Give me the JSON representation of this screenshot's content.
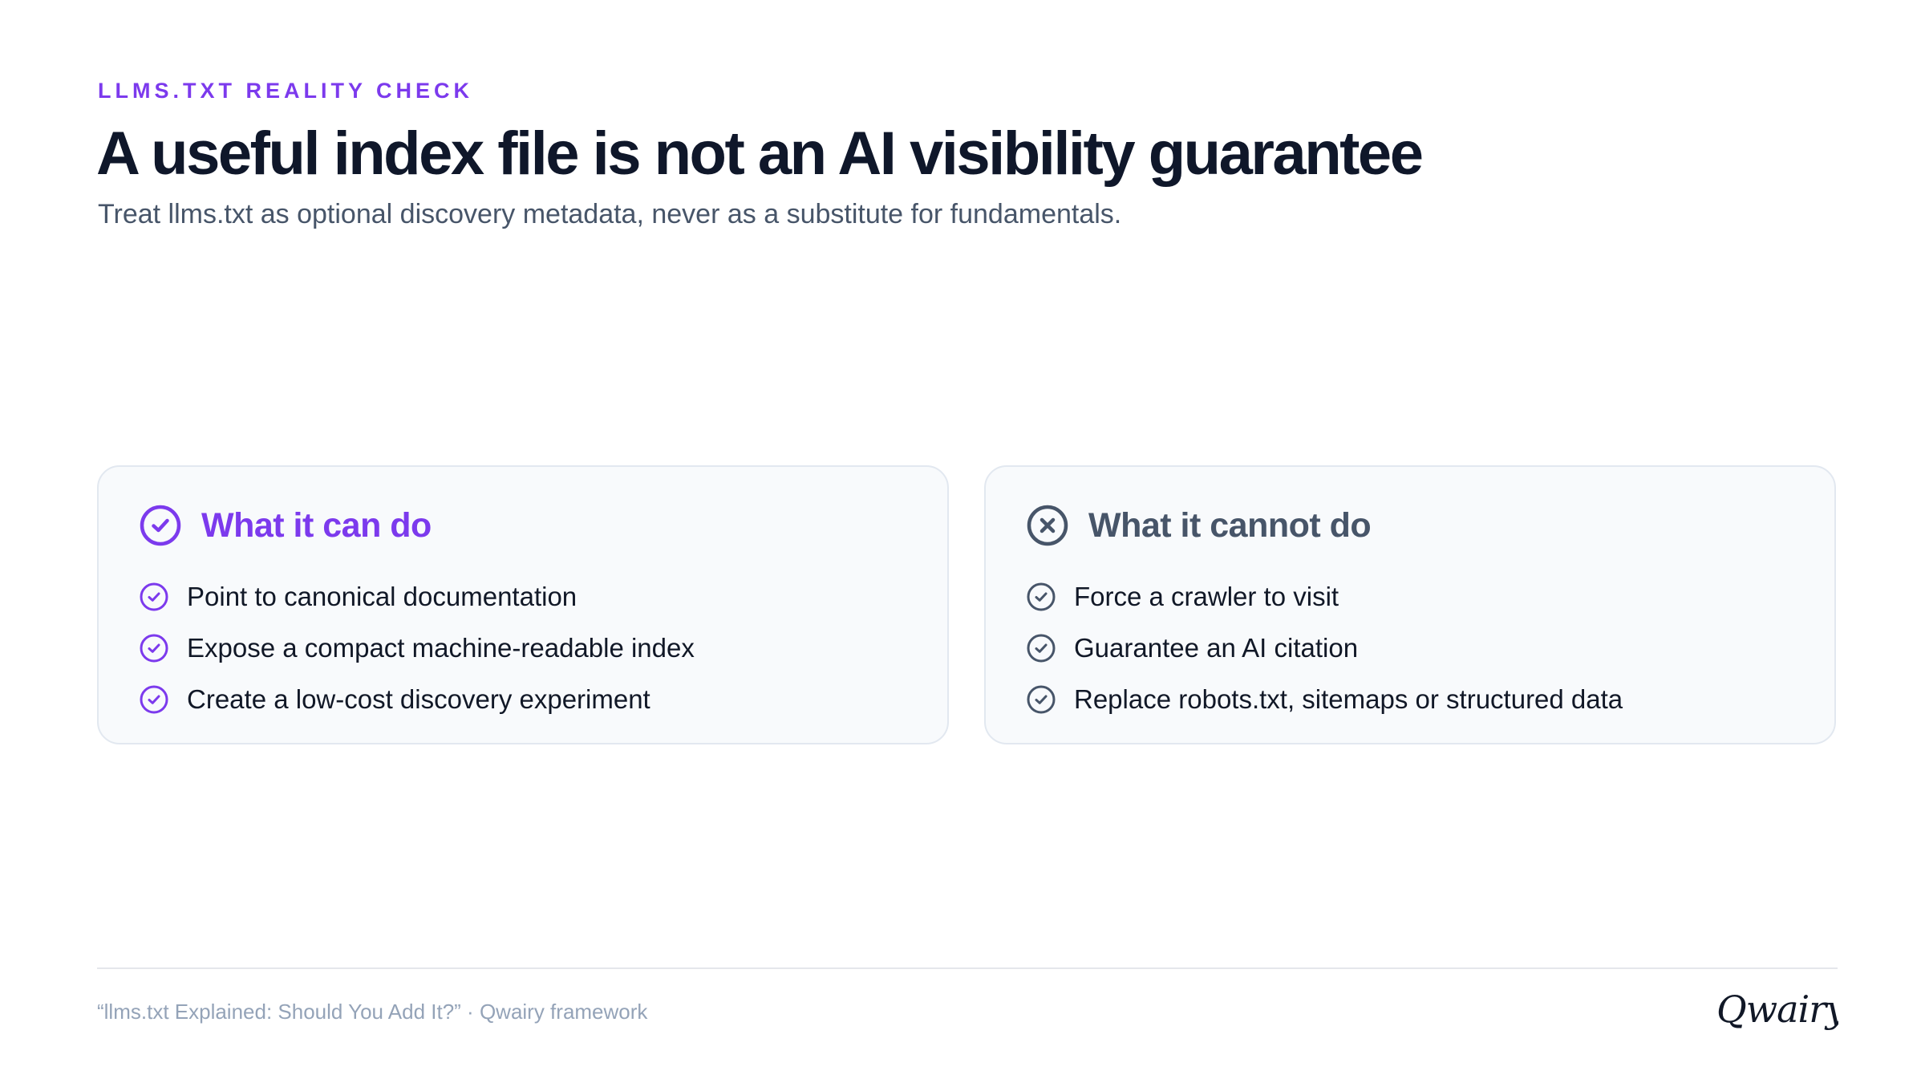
{
  "header": {
    "eyebrow": "LLMS.TXT REALITY CHECK",
    "title": "A useful index file is not an AI visibility guarantee",
    "subtitle": "Treat llms.txt as optional discovery metadata, never as a substitute for fundamentals."
  },
  "cards": {
    "can": {
      "title": "What it can do",
      "icon": "check-circle-icon",
      "color": "#7c3aed",
      "items": [
        "Point to canonical documentation",
        "Expose a compact machine-readable index",
        "Create a low-cost discovery experiment"
      ]
    },
    "cannot": {
      "title": "What it cannot do",
      "icon": "x-circle-icon",
      "color": "#475569",
      "items": [
        "Force a crawler to visit",
        "Guarantee an AI citation",
        "Replace robots.txt, sitemaps or structured data"
      ]
    }
  },
  "footer": {
    "note": "“llms.txt Explained: Should You Add It?” · Qwairy framework",
    "logo_text": "Qwairy"
  }
}
